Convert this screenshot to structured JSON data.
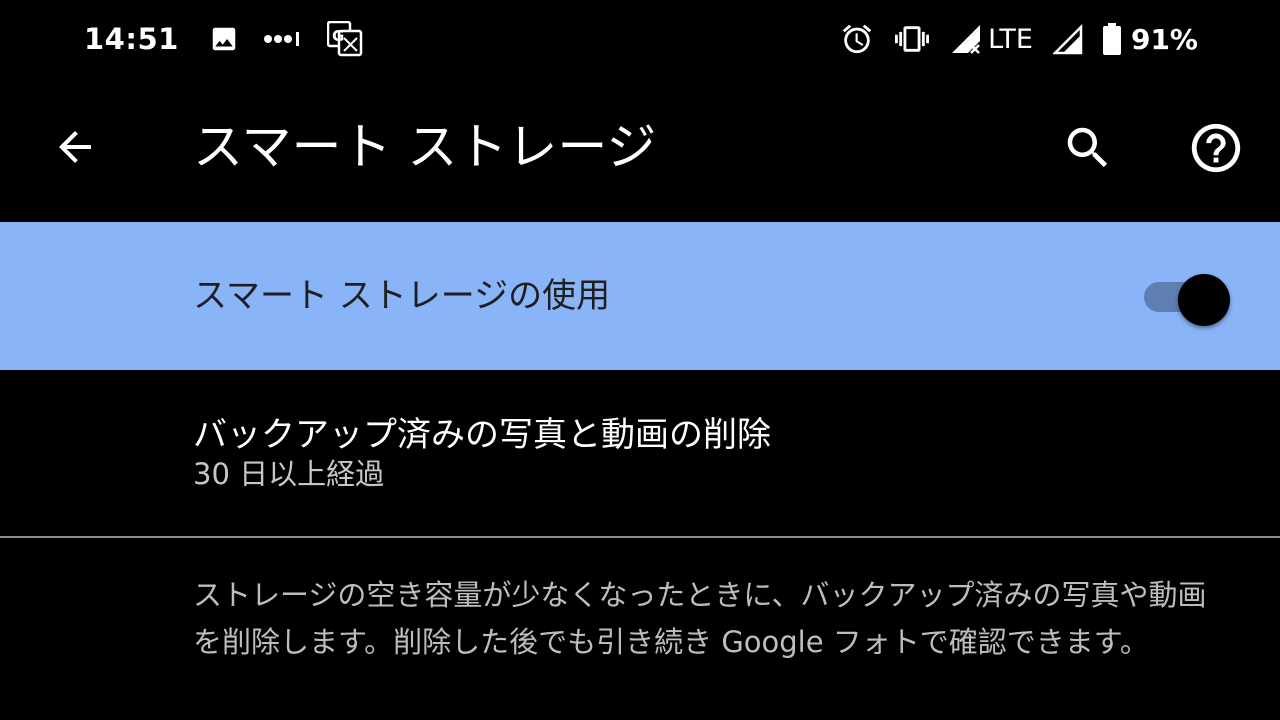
{
  "status_bar": {
    "time": "14:51",
    "network": "LTE",
    "battery": "91%",
    "icons": [
      "image-icon",
      "more-dots-icon",
      "translate-icon",
      "alarm-icon",
      "vibrate-icon",
      "signal-no-data-icon",
      "signal-icon",
      "battery-icon"
    ]
  },
  "app_bar": {
    "title": "スマート ストレージ",
    "back_icon": "arrow-back-icon",
    "search_icon": "search-icon",
    "help_icon": "help-icon"
  },
  "toggle": {
    "label": "スマート ストレージの使用",
    "checked": true
  },
  "setting": {
    "title": "バックアップ済みの写真と動画の削除",
    "summary": "30 日以上経過"
  },
  "description": "ストレージの空き容量が少なくなったときに、バックアップ済みの写真や動画を削除します。削除した後でも引き続き Google フォトで確認できます。",
  "colors": {
    "background": "#000000",
    "highlight": "#8ab4f8",
    "switch_track": "#5f7fb3",
    "divider": "#8e8e8e",
    "secondary_text": "#bdbdbd"
  }
}
